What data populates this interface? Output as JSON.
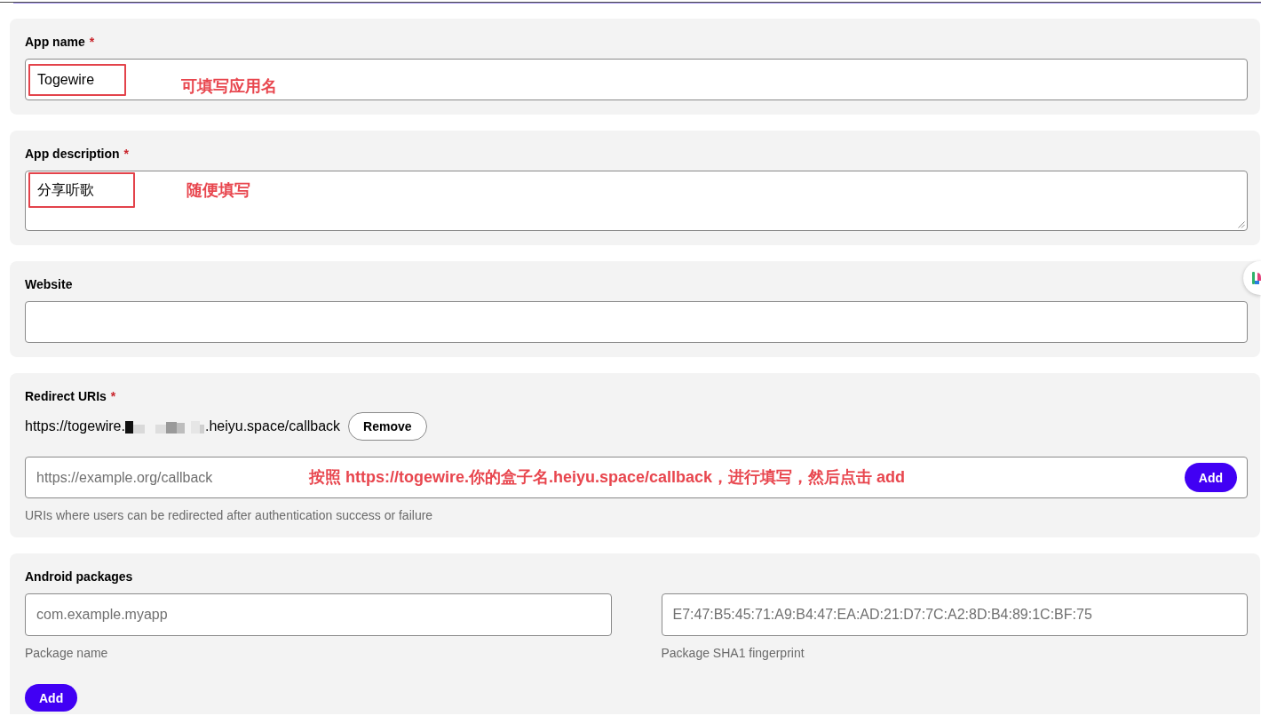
{
  "sections": [
    {
      "kind": "text",
      "label": "App name",
      "required_mark": "*",
      "field": {
        "value": "Togewire",
        "highlighted": true,
        "annotation": "可填写应用名"
      }
    },
    {
      "kind": "textarea",
      "label": "App description",
      "required_mark": "*",
      "field": {
        "value": "分享听歌",
        "highlighted": true,
        "annotation": "随便填写"
      }
    },
    {
      "kind": "text",
      "label": "Website"
    },
    {
      "kind": "uris",
      "label": "Redirect URIs",
      "required_mark": "*",
      "uris": [
        {
          "prefix": "https://togewire.",
          "redacted": true,
          "suffix": ".heiyu.space/callback",
          "remove_label": "Remove"
        }
      ],
      "field": {
        "placeholder": "https://example.org/callback",
        "annotation": "按照 https://togewire.你的盒子名.heiyu.space/callback，进行填写，然后点击 add",
        "button": "Add"
      },
      "hint": "URIs where users can be redirected after authentication success or failure"
    },
    {
      "kind": "packages",
      "label": "Android packages",
      "fields": [
        {
          "placeholder": "com.example.myapp",
          "hint": "Package name"
        },
        {
          "placeholder": "E7:47:B5:45:71:A9:B4:47:EA:AD:21:D7:7C:A2:8D:B4:89:1C:BF:75",
          "hint": "Package SHA1 fingerprint"
        }
      ],
      "button": "Add"
    }
  ]
}
